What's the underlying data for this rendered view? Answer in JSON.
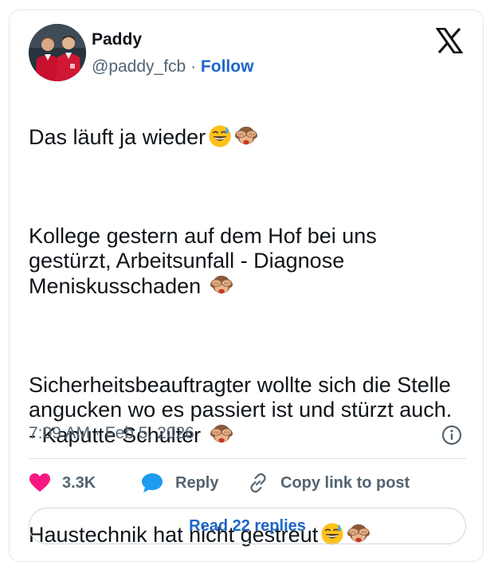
{
  "author": {
    "name": "Paddy",
    "handle": "@paddy_fcb",
    "separator": "·",
    "follow_label": "Follow"
  },
  "tweet": {
    "paragraphs": [
      "Das läuft ja wieder",
      "Kollege gestern auf dem Hof bei uns gestürzt, Arbeitsunfall - Diagnose Meniskusschaden",
      "Sicherheitsbeauftragter wollte sich die Stelle angucken wo es passiert ist und stürzt auch. - Kaputte Schulter",
      "Haustechnik hat nicht gestreut"
    ],
    "emoji": [
      "grinning-sweat-emoji",
      "see-no-evil-monkey-emoji"
    ]
  },
  "meta": {
    "time": "7:09 AM",
    "separator": "·",
    "date": "Feb 5, 2026"
  },
  "actions": {
    "likes": "3.3K",
    "reply_label": "Reply",
    "copy_label": "Copy link to post"
  },
  "read_replies_label": "Read 22 replies",
  "icons": {
    "logo": "x-logo-icon",
    "info": "info-icon",
    "like": "heart-icon",
    "reply": "speech-bubble-icon",
    "copy": "link-icon"
  },
  "colors": {
    "accent": "#1d66c8",
    "heart": "#f91880",
    "reply_bubble": "#1d9bf0",
    "secondary_text": "#536471"
  }
}
